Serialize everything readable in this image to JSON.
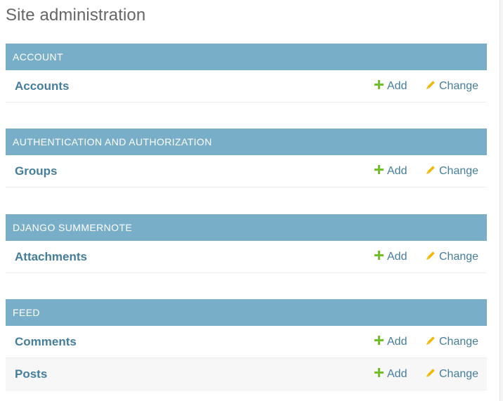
{
  "page": {
    "title": "Site administration"
  },
  "colors": {
    "caption_bg": "#79aec8",
    "link": "#447e9b",
    "add_icon": "#70bf2b",
    "change_icon": "#efb80b"
  },
  "labels": {
    "add": "Add",
    "change": "Change"
  },
  "apps": [
    {
      "caption": "Account",
      "models": [
        {
          "name": "Accounts"
        }
      ]
    },
    {
      "caption": "Authentication and Authorization",
      "models": [
        {
          "name": "Groups"
        }
      ]
    },
    {
      "caption": "Django Summernote",
      "models": [
        {
          "name": "Attachments"
        }
      ]
    },
    {
      "caption": "Feed",
      "models": [
        {
          "name": "Comments"
        },
        {
          "name": "Posts"
        }
      ]
    }
  ]
}
